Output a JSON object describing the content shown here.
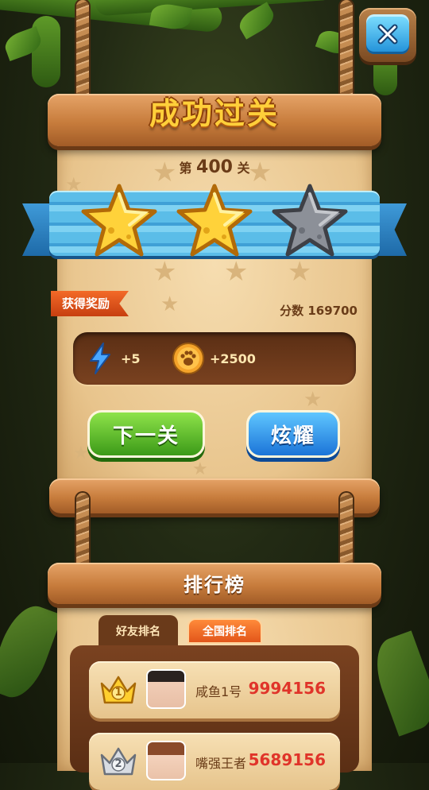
{
  "header": {
    "title": "成功过关"
  },
  "level": {
    "prefix": "第",
    "number": "400",
    "suffix": "关"
  },
  "stars": {
    "earned": 2,
    "total": 3
  },
  "rewards": {
    "tag": "获得奖励",
    "score_label": "分数",
    "score_value": "169700",
    "energy": "+5",
    "coins": "+2500"
  },
  "buttons": {
    "next": "下一关",
    "share": "炫耀"
  },
  "leaderboard": {
    "title": "排行榜",
    "tabs": [
      {
        "label": "好友排名",
        "active": true
      },
      {
        "label": "全国排名",
        "active": false
      }
    ],
    "entries": [
      {
        "rank": "1",
        "name": "咸鱼1号",
        "score": "9994156",
        "crown": "gold-crown-icon"
      },
      {
        "rank": "2",
        "name": "嘴强王者",
        "score": "5689156",
        "crown": "silver-crown-icon"
      }
    ]
  },
  "colors": {
    "title_yellow": "#ffcf3a",
    "ribbon_blue": "#3fa0d6",
    "next_green": "#3c9a18",
    "share_blue": "#1b74d8",
    "score_red": "#e0342a",
    "tag_orange": "#e2561a"
  }
}
